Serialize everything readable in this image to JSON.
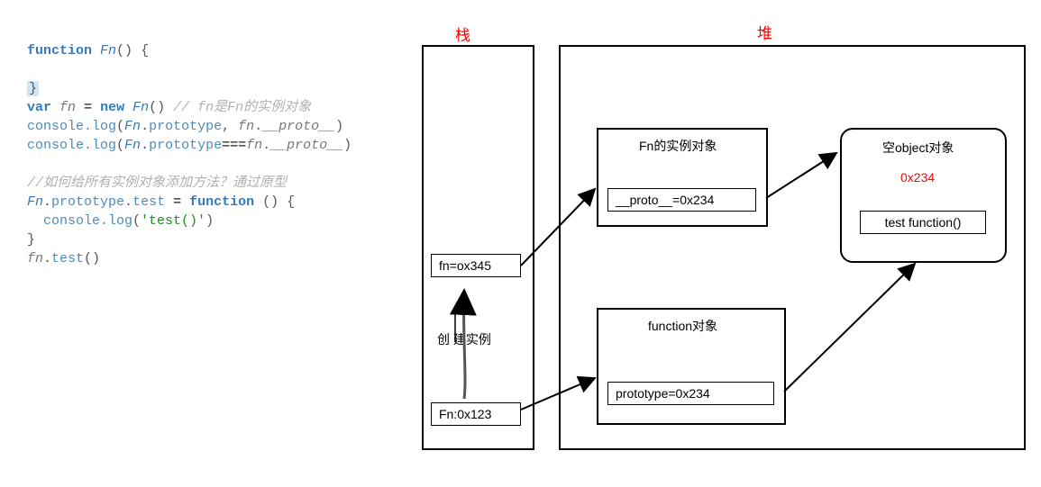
{
  "code": {
    "l1_kw_function": "function",
    "l1_fn": "Fn",
    "l1_parens": "()",
    "l1_brace": "{",
    "l3_brace": "}",
    "l4_kw_var": "var",
    "l4_varname": "fn",
    "l4_eq": " = ",
    "l4_kw_new": "new",
    "l4_fn": "Fn",
    "l4_parens": "()",
    "l4_comment": " // fn是Fn的实例对象",
    "l5_console": "console",
    "l5_log": ".log",
    "l5_args": "(Fn.prototype, fn.__proto__)",
    "l5_fnpart": "Fn",
    "l5_dot1": ".",
    "l5_proto": "prototype",
    "l5_comma": ", ",
    "l5_fnvar": "fn",
    "l5_dot2": ".",
    "l5_dunder": "__proto__",
    "l6_console": "console",
    "l6_log": ".log",
    "l6_open": "(",
    "l6_fn": "Fn",
    "l6_dot1": ".",
    "l6_proto": "prototype",
    "l6_eqeq": "===",
    "l6_fnvar": "fn",
    "l6_dot2": ".",
    "l6_dunder": "__proto__",
    "l6_close": ")",
    "l8_comment": "//如何给所有实例对象添加方法？通过原型",
    "l9_fn": "Fn",
    "l9_dot1": ".",
    "l9_proto": "prototype",
    "l9_dot2": ".",
    "l9_test": "test",
    "l9_eq": " = ",
    "l9_kw_function": "function",
    "l9_parens": " ()",
    "l9_brace": " {",
    "l10_console": "  console",
    "l10_log": ".log",
    "l10_open": "(",
    "l10_str": "'test()'",
    "l10_close": ")",
    "l11_brace": "}",
    "l12_fn": "fn",
    "l12_dot": ".",
    "l12_test": "test",
    "l12_parens": "()"
  },
  "diagram": {
    "stack_title": "栈",
    "heap_title": "堆",
    "fn_box": "fn=ox345",
    "create_label": "创 建实例",
    "fn_ptr_box": "Fn:0x123",
    "instance_title": "Fn的实例对象",
    "instance_proto": "__proto__=0x234",
    "function_title": "function对象",
    "function_proto": "prototype=0x234",
    "empty_title": "空object对象",
    "empty_addr": "0x234",
    "test_fn": "test function()"
  }
}
